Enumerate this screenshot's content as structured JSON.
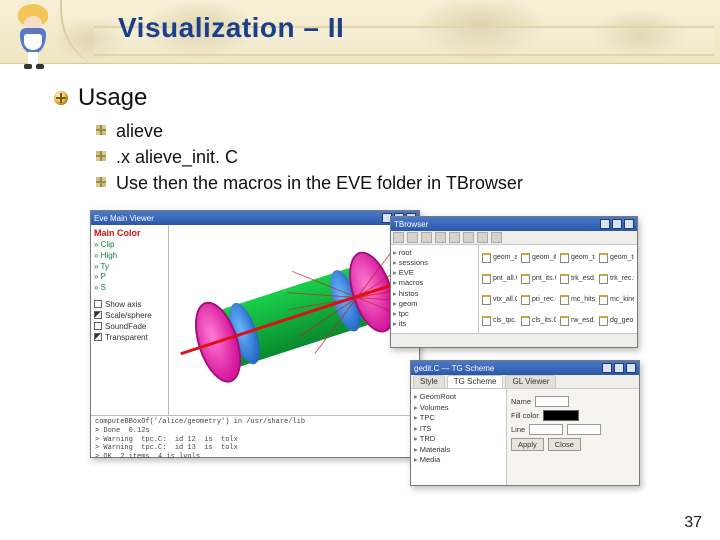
{
  "header": {
    "title": "Visualization – II"
  },
  "usage": {
    "label": "Usage",
    "items": [
      "alieve",
      ".x alieve_init. C",
      "Use then the macros in the EVE folder in TBrowser"
    ]
  },
  "viewer": {
    "title": "Eve  Main Viewer",
    "panel_header": "Main  Color",
    "panel_rows": [
      "» Clip",
      "» High",
      "» Ty",
      "» P",
      "» S"
    ],
    "checks": [
      {
        "label": "Show axis",
        "on": false
      },
      {
        "label": "Scale/sphere",
        "on": true
      },
      {
        "label": "SoundFade",
        "on": false
      },
      {
        "label": "Transparent",
        "on": true
      }
    ],
    "console": "computeBBoxOf('/alice/geometry') in /usr/share/lib\n> Done  0.12s\n> Warning  tpc.C:  id 12  is  tolx\n> Warning  tpc.C:  id 13  is  tolx\n> OK  2 items  4 is lvols"
  },
  "browser": {
    "title": "TBrowser",
    "tree": [
      "root",
      "sessions",
      "EVE",
      "macros",
      "histos",
      "geom",
      "tpc",
      "its"
    ],
    "files": [
      "geom_all.C",
      "geom_its.C",
      "geom_tpc.C",
      "geom_trd.C",
      "pnt_all.C",
      "pnt_its.C",
      "trk_esd.C",
      "trk_rec.C",
      "vtx_all.C",
      "pri_rec.C",
      "mc_hits.C",
      "mc_kine.C",
      "cls_tpc.C",
      "cls_its.C",
      "rw_esd.C",
      "dg_geo.C"
    ]
  },
  "editor": {
    "title": "gedit.C — TG Scheme",
    "tabs": [
      "Style",
      "TG Scheme",
      "GL Viewer"
    ],
    "tree": [
      "GeomRoot",
      "Volumes",
      "TPC",
      "ITS",
      "TRD",
      "Materials",
      "Media"
    ],
    "fields": {
      "name_label": "Name",
      "color_label": "Fill color",
      "line_label": "Line",
      "apply": "Apply",
      "close": "Close"
    }
  },
  "page_number": "37"
}
